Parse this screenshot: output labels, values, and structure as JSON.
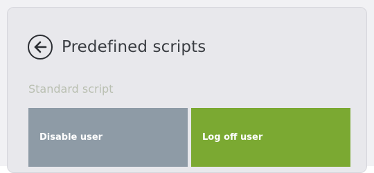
{
  "header": {
    "back_icon": "arrow-left-circle-icon",
    "title": "Predefined scripts"
  },
  "section": {
    "label": "Standard script"
  },
  "scripts": [
    {
      "label": "Disable user",
      "color": "#8e9ba6"
    },
    {
      "label": "Log off user",
      "color": "#7ba932"
    }
  ]
}
